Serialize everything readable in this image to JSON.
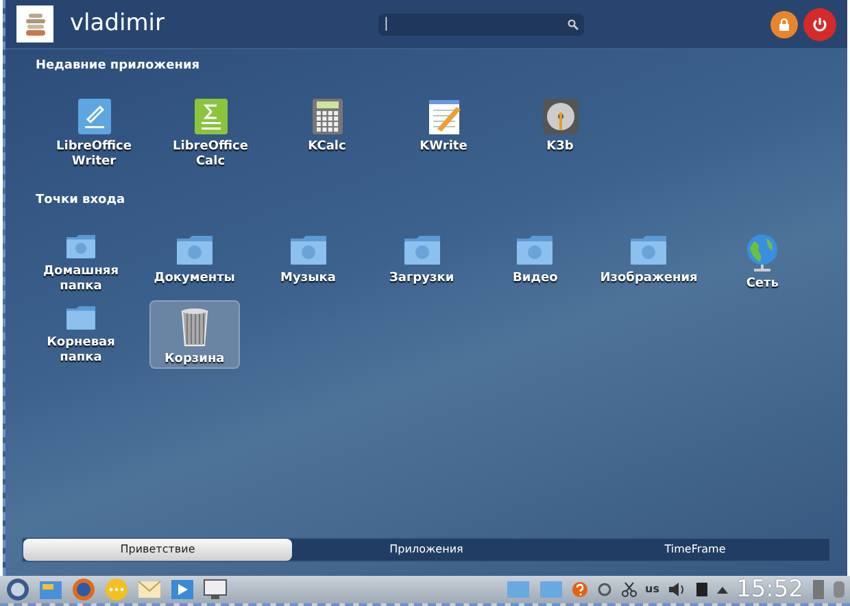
{
  "user": {
    "name": "vladimir"
  },
  "search": {
    "value": "|"
  },
  "recent": {
    "title": "Недавние приложения",
    "items": [
      {
        "label": "LibreOffice Writer"
      },
      {
        "label": "LibreOffice Calc"
      },
      {
        "label": "KCalc"
      },
      {
        "label": "KWrite"
      },
      {
        "label": "K3b"
      }
    ]
  },
  "places": {
    "title": "Точки входа",
    "items": [
      {
        "label": "Домашняя папка",
        "selected": false
      },
      {
        "label": "Документы",
        "selected": false
      },
      {
        "label": "Музыка",
        "selected": false
      },
      {
        "label": "Загрузки",
        "selected": false
      },
      {
        "label": "Видео",
        "selected": false
      },
      {
        "label": "Изображения",
        "selected": false
      },
      {
        "label": "Сеть",
        "selected": false
      },
      {
        "label": "Корневая папка",
        "selected": false
      },
      {
        "label": "Корзина",
        "selected": true
      }
    ]
  },
  "tabs": [
    {
      "label": "Приветствие",
      "selected": true
    },
    {
      "label": "Приложения",
      "selected": false
    },
    {
      "label": "TimeFrame",
      "selected": false
    }
  ],
  "taskbar": {
    "keyboard_layout": "us",
    "clock": "15:52"
  }
}
